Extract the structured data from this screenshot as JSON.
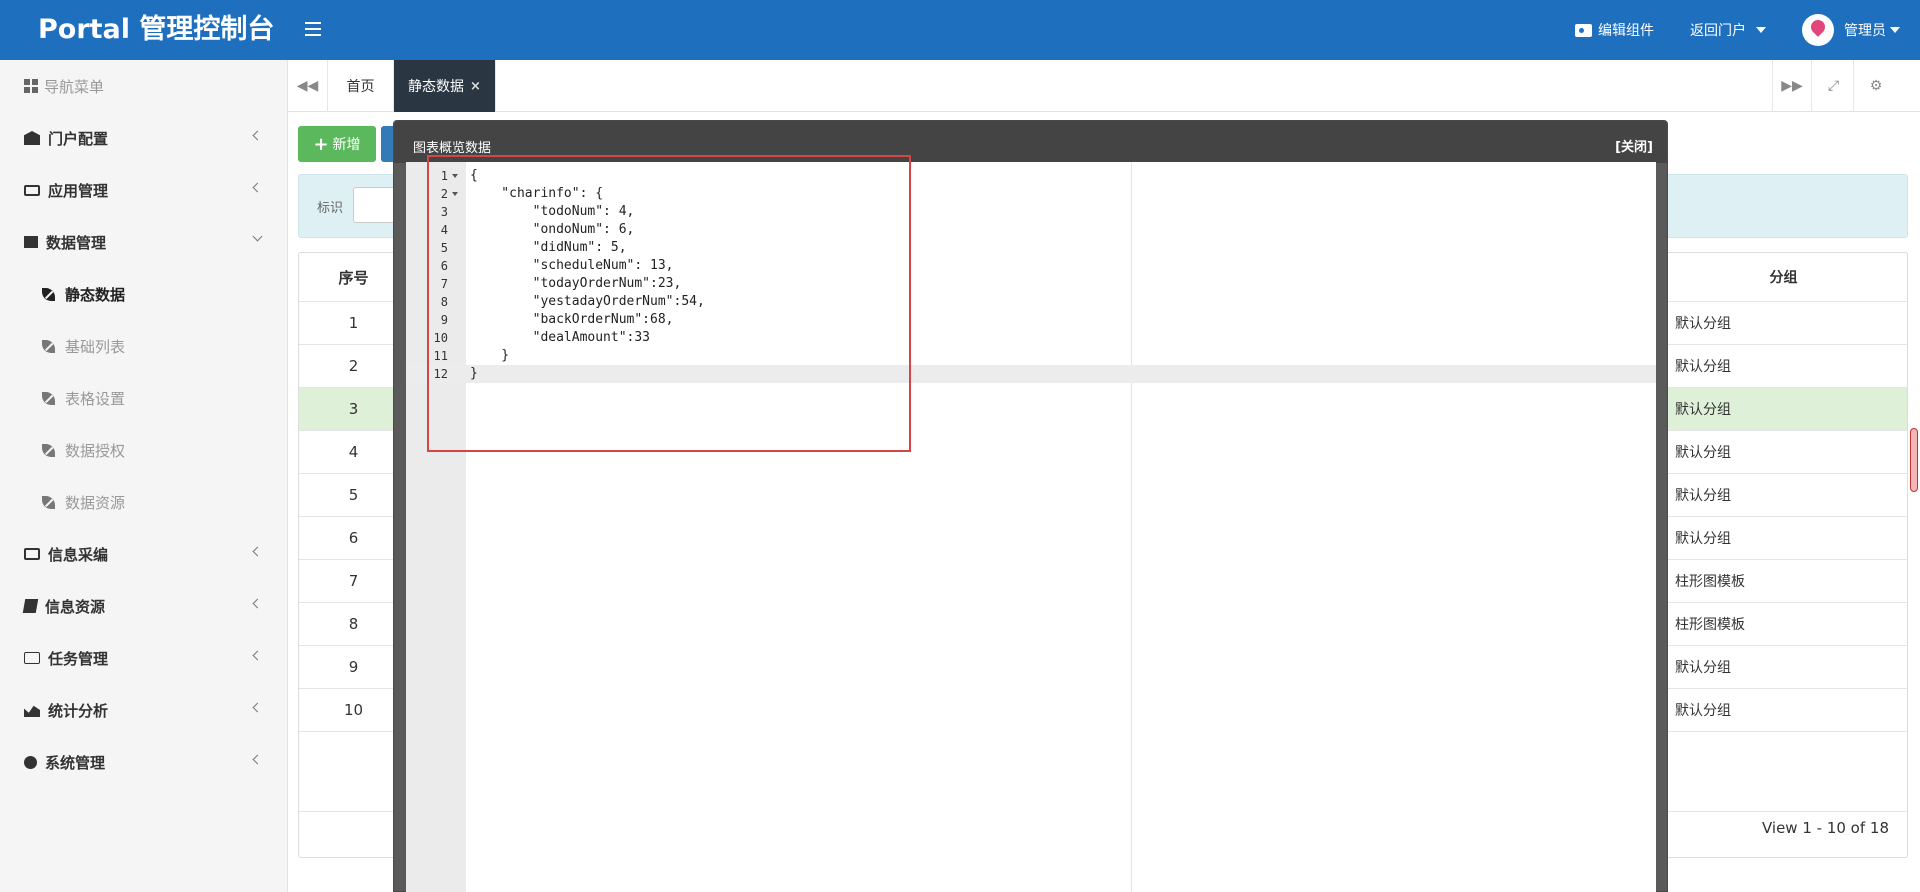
{
  "header": {
    "brand": "Portal 管理控制台",
    "edit_widgets": "编辑组件",
    "return_portal": "返回门户",
    "admin": "管理员"
  },
  "sidebar": {
    "title": "导航菜单",
    "items": [
      {
        "label": "门户配置",
        "icon": "bank-icon"
      },
      {
        "label": "应用管理",
        "icon": "laptop-icon"
      },
      {
        "label": "数据管理",
        "icon": "server-icon",
        "expanded": true
      },
      {
        "label": "信息采编",
        "icon": "id-card-icon"
      },
      {
        "label": "信息资源",
        "icon": "book-icon"
      },
      {
        "label": "任务管理",
        "icon": "folder-icon"
      },
      {
        "label": "统计分析",
        "icon": "area-chart-icon"
      },
      {
        "label": "系统管理",
        "icon": "cogs-icon"
      }
    ],
    "sub_items": [
      {
        "label": "静态数据",
        "active": true
      },
      {
        "label": "基础列表"
      },
      {
        "label": "表格设置"
      },
      {
        "label": "数据授权"
      },
      {
        "label": "数据资源"
      }
    ]
  },
  "tabs": [
    {
      "label": "首页"
    },
    {
      "label": "静态数据",
      "active": true,
      "close": "×"
    }
  ],
  "toolbar": {
    "new_label": "新增",
    "new_icon": "+"
  },
  "search": {
    "label": "标识"
  },
  "table": {
    "col_index": "序号",
    "col_group": "分组",
    "rows": [
      {
        "index": "1",
        "group": "默认分组"
      },
      {
        "index": "2",
        "group": "默认分组"
      },
      {
        "index": "3",
        "group": "默认分组",
        "selected": true
      },
      {
        "index": "4",
        "group": "默认分组"
      },
      {
        "index": "5",
        "group": "默认分组"
      },
      {
        "index": "6",
        "group": "默认分组"
      },
      {
        "index": "7",
        "group": "柱形图模板"
      },
      {
        "index": "8",
        "group": "柱形图模板"
      },
      {
        "index": "9",
        "group": "默认分组"
      },
      {
        "index": "10",
        "group": "默认分组"
      }
    ],
    "pager": "View 1 - 10 of 18"
  },
  "modal": {
    "title": "图表概览数据",
    "close_label": "[关闭]",
    "code_lines": [
      "{",
      "    \"charinfo\": {",
      "        \"todoNum\": 4,",
      "        \"ondoNum\": 6,",
      "        \"didNum\": 5,",
      "        \"scheduleNum\": 13,",
      "        \"todayOrderNum\":23,",
      "        \"yestadayOrderNum\":54,",
      "        \"backOrderNum\":68,",
      "        \"dealAmount\":33",
      "    }",
      "}"
    ]
  },
  "colors": {
    "header_bg": "#1f6fbf",
    "active_tab_bg": "#2b3643",
    "new_button": "#5cb85c",
    "selected_row": "#dff0d8",
    "annotation_box": "#d64545"
  }
}
